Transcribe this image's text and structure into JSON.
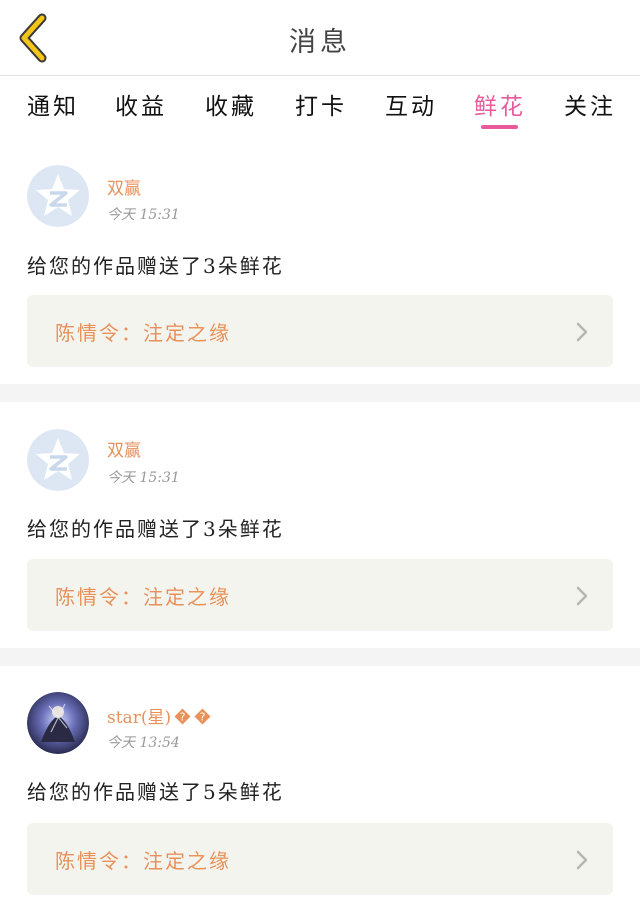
{
  "header": {
    "title": "消息"
  },
  "tabs": [
    {
      "label": "通知"
    },
    {
      "label": "收益"
    },
    {
      "label": "收藏"
    },
    {
      "label": "打卡"
    },
    {
      "label": "互动"
    },
    {
      "label": "鲜花"
    },
    {
      "label": "关注"
    }
  ],
  "active_tab": "鲜花",
  "colors": {
    "accent_pink": "#e85a9c",
    "name_orange": "#e8915a",
    "card_bg": "#f4f4ee"
  },
  "messages": [
    {
      "name": "双赢",
      "time": "今天 15:31",
      "text": "给您的作品赠送了3朵鲜花",
      "work": "陈情令：注定之缘",
      "avatar": "default-z-avatar"
    },
    {
      "name": "双赢",
      "time": "今天 15:31",
      "text": "给您的作品赠送了3朵鲜花",
      "work": "陈情令：注定之缘",
      "avatar": "default-z-avatar"
    },
    {
      "name": "star(星)",
      "time": "今天 13:54",
      "text": "给您的作品赠送了5朵鲜花",
      "work": "陈情令：注定之缘",
      "avatar": "photo-avatar"
    }
  ]
}
